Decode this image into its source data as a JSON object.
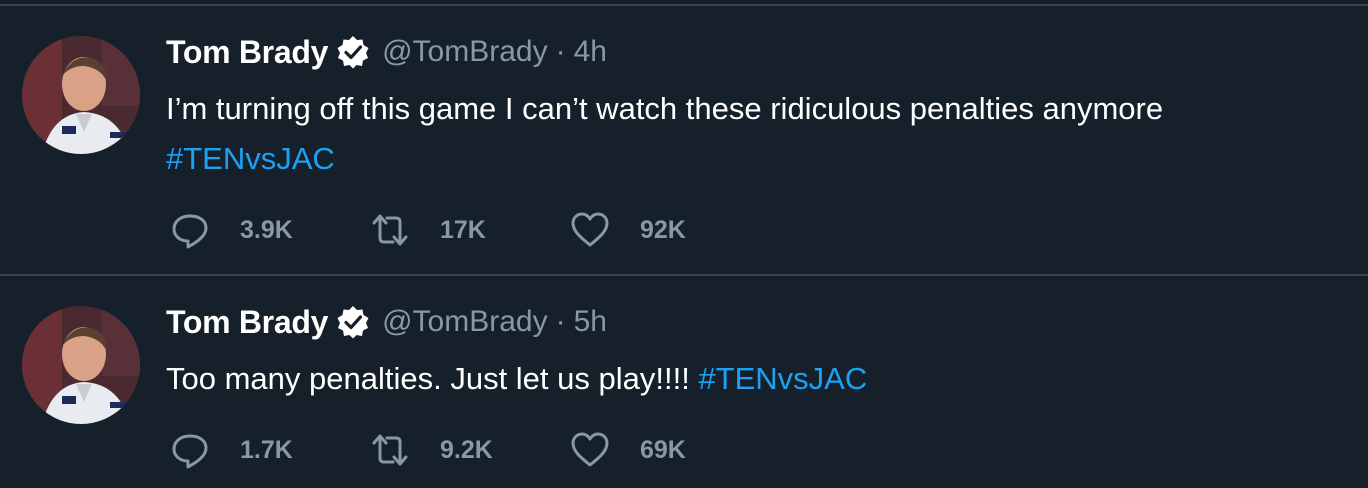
{
  "colors": {
    "background": "#15202b",
    "divider": "#38444d",
    "name": "#ffffff",
    "secondary": "#8899a6",
    "hashtag": "#1da1f2",
    "verified": "#ffffff"
  },
  "icons": {
    "reply": "speech-bubble-icon",
    "retweet": "retweet-arrows-icon",
    "like": "heart-icon",
    "verified": "verified-badge-icon"
  },
  "tweets": [
    {
      "name": "Tom Brady",
      "handle": "@TomBrady",
      "separator": "·",
      "time": "4h",
      "text": "I’m turning off this game I can’t watch these ridiculous penalties anymore ",
      "hashtag": "#TENvsJAC",
      "replies": "3.9K",
      "retweets": "17K",
      "likes": "92K"
    },
    {
      "name": "Tom Brady",
      "handle": "@TomBrady",
      "separator": "·",
      "time": "5h",
      "text": "Too many penalties. Just let us play!!!!  ",
      "hashtag": "#TENvsJAC",
      "replies": "1.7K",
      "retweets": "9.2K",
      "likes": "69K"
    }
  ]
}
